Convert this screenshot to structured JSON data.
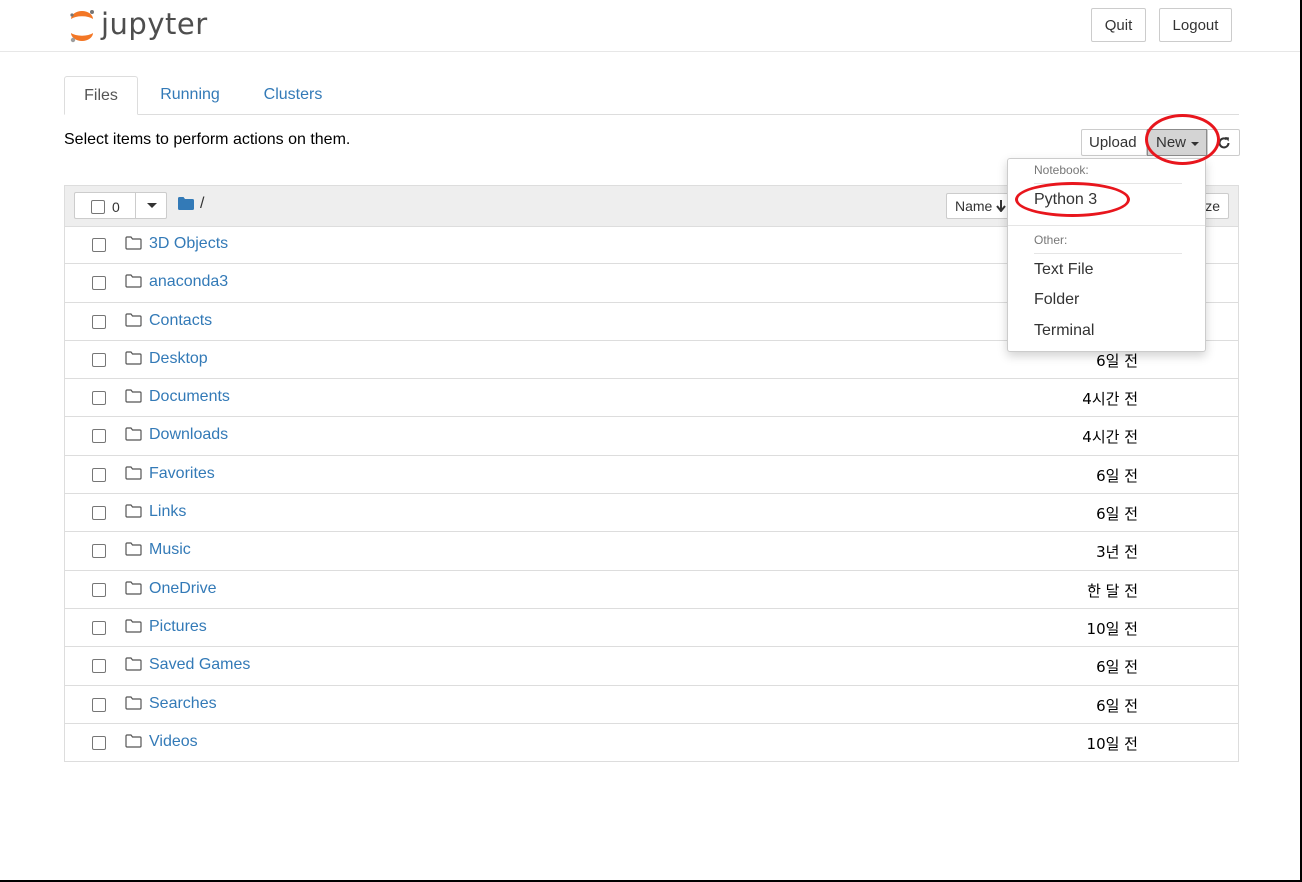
{
  "header": {
    "logo_text": "jupyter",
    "quit_label": "Quit",
    "logout_label": "Logout"
  },
  "tabs": [
    {
      "label": "Files",
      "active": true
    },
    {
      "label": "Running",
      "active": false
    },
    {
      "label": "Clusters",
      "active": false
    }
  ],
  "toolbar": {
    "hint": "Select items to perform actions on them.",
    "upload_label": "Upload",
    "new_label": "New"
  },
  "listing": {
    "selected_count": "0",
    "path": "/",
    "sort_name_label": "Name",
    "sort_size_label": "ze",
    "items": [
      {
        "name": "3D Objects",
        "date": ""
      },
      {
        "name": "anaconda3",
        "date": ""
      },
      {
        "name": "Contacts",
        "date": ""
      },
      {
        "name": "Desktop",
        "date": "6일 전"
      },
      {
        "name": "Documents",
        "date": "4시간 전"
      },
      {
        "name": "Downloads",
        "date": "4시간 전"
      },
      {
        "name": "Favorites",
        "date": "6일 전"
      },
      {
        "name": "Links",
        "date": "6일 전"
      },
      {
        "name": "Music",
        "date": "3년 전"
      },
      {
        "name": "OneDrive",
        "date": "한 달 전"
      },
      {
        "name": "Pictures",
        "date": "10일 전"
      },
      {
        "name": "Saved Games",
        "date": "6일 전"
      },
      {
        "name": "Searches",
        "date": "6일 전"
      },
      {
        "name": "Videos",
        "date": "10일 전"
      }
    ]
  },
  "new_menu": {
    "notebook_header": "Notebook:",
    "python3_label": "Python 3",
    "other_header": "Other:",
    "text_file_label": "Text File",
    "folder_label": "Folder",
    "terminal_label": "Terminal"
  },
  "colors": {
    "link": "#337ab7",
    "annotation": "#e8161d",
    "logo_orange": "#f37726"
  }
}
